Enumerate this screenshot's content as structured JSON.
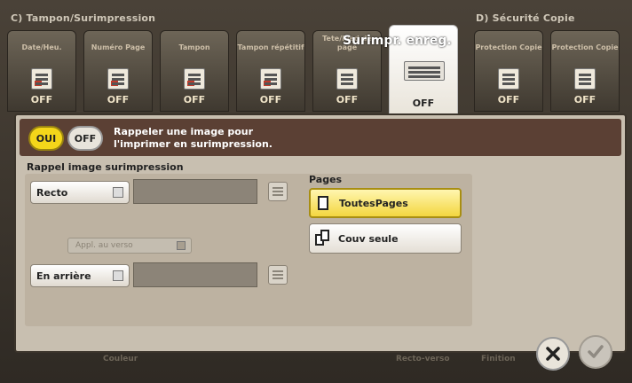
{
  "header": {
    "group_c": "C)  Tampon/Surimpression",
    "group_d": "D)  Sécurité Copie",
    "active_title": "Surimpr. enreg."
  },
  "tabs": [
    {
      "label": "Date/Heu.",
      "state": "OFF",
      "icon": "date-time-icon"
    },
    {
      "label": "Numéro Page",
      "state": "OFF",
      "icon": "page-number-icon"
    },
    {
      "label": "Tampon",
      "state": "OFF",
      "icon": "stamp-icon"
    },
    {
      "label": "Tampon répétitif",
      "state": "OFF",
      "icon": "repeat-stamp-icon"
    },
    {
      "label": "Tete/Pied de page",
      "state": "OFF",
      "icon": "header-footer-icon"
    },
    {
      "label": "Surimpr. enreg.",
      "state": "OFF",
      "icon": "registered-overlay-icon"
    },
    {
      "label": "Protection Copie",
      "state": "OFF",
      "icon": "copy-protect-icon"
    },
    {
      "label": "Protection Copie",
      "state": "OFF",
      "icon": "copy-guard-icon"
    }
  ],
  "message": {
    "on_label": "OUI",
    "off_label": "OFF",
    "line1": "Rappeler une image pour",
    "line2": "l'imprimer en surimpression."
  },
  "recall": {
    "title": "Rappel image surimpression",
    "front_label": "Recto",
    "front_value": "",
    "apply_back_label": "Appl. au verso",
    "back_label": "En arrière",
    "back_value": ""
  },
  "pages": {
    "title": "Pages",
    "all_pages": "ToutesPages",
    "cover_only": "Couv seule",
    "selected": "ToutesPages"
  },
  "footer": {
    "color_label": "Couleur",
    "duplex_label": "Recto-verso",
    "finish_label": "Finition"
  },
  "colors": {
    "accent": "#f3d640",
    "message_bg": "#5b4034",
    "panel_bg": "#c8bfb0"
  }
}
